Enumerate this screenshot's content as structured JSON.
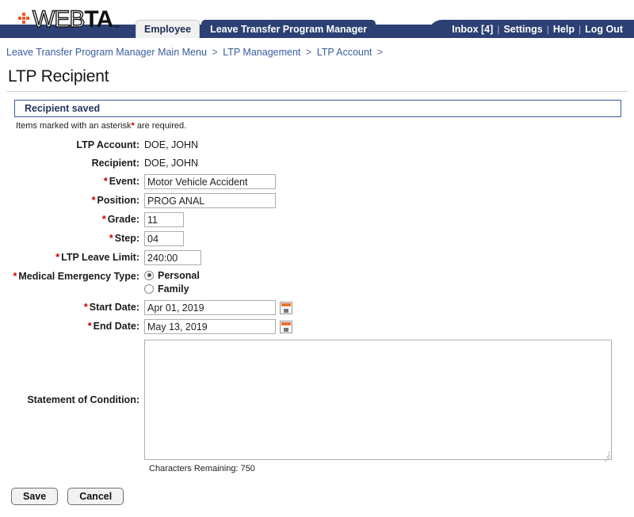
{
  "app": {
    "logo_web": "WEB",
    "logo_ta": "TA",
    "logo_tm": "™"
  },
  "header": {
    "tabs": [
      {
        "label": "Employee",
        "active": false
      },
      {
        "label": "Leave Transfer Program Manager",
        "active": true
      }
    ],
    "usernav": [
      {
        "label": "Inbox [4]"
      },
      {
        "label": "Settings"
      },
      {
        "label": "Help"
      },
      {
        "label": "Log Out"
      }
    ],
    "usernav_separator": "|"
  },
  "breadcrumb": {
    "items": [
      "Leave Transfer Program Manager Main Menu",
      "LTP Management",
      "LTP Account"
    ],
    "separator": ">",
    "trailing": ">"
  },
  "page": {
    "title": "LTP Recipient",
    "message": "Recipient saved",
    "required_note_before": "Items marked with an asterisk",
    "required_note_asterisk": "*",
    "required_note_after": " are required."
  },
  "form": {
    "asterisk": "*",
    "ltp_account": {
      "label": "LTP Account:",
      "value": "DOE, JOHN"
    },
    "recipient": {
      "label": "Recipient:",
      "value": "DOE, JOHN"
    },
    "event": {
      "label": "Event:",
      "value": "Motor Vehicle Accident"
    },
    "position": {
      "label": "Position:",
      "value": "PROG ANAL"
    },
    "grade": {
      "label": "Grade:",
      "value": "11"
    },
    "step": {
      "label": "Step:",
      "value": "04"
    },
    "leave_limit": {
      "label": "LTP Leave Limit:",
      "value": "240:00"
    },
    "medical_emergency_type": {
      "label": "Medical Emergency Type:",
      "options": [
        {
          "label": "Personal",
          "selected": true
        },
        {
          "label": "Family",
          "selected": false
        }
      ]
    },
    "start_date": {
      "label": "Start Date:",
      "value": "Apr 01, 2019"
    },
    "end_date": {
      "label": "End Date:",
      "value": "May 13, 2019"
    },
    "statement_of_condition": {
      "label": "Statement of Condition:",
      "value": "",
      "characters_remaining": "Characters Remaining: 750"
    }
  },
  "actions": {
    "save": "Save",
    "cancel": "Cancel"
  },
  "colors": {
    "navy": "#2c4073",
    "link": "#3a5ba0",
    "required_red": "#cc0000",
    "logo_orange": "#e8572a",
    "calendar_orange": "#ee6f2d"
  }
}
